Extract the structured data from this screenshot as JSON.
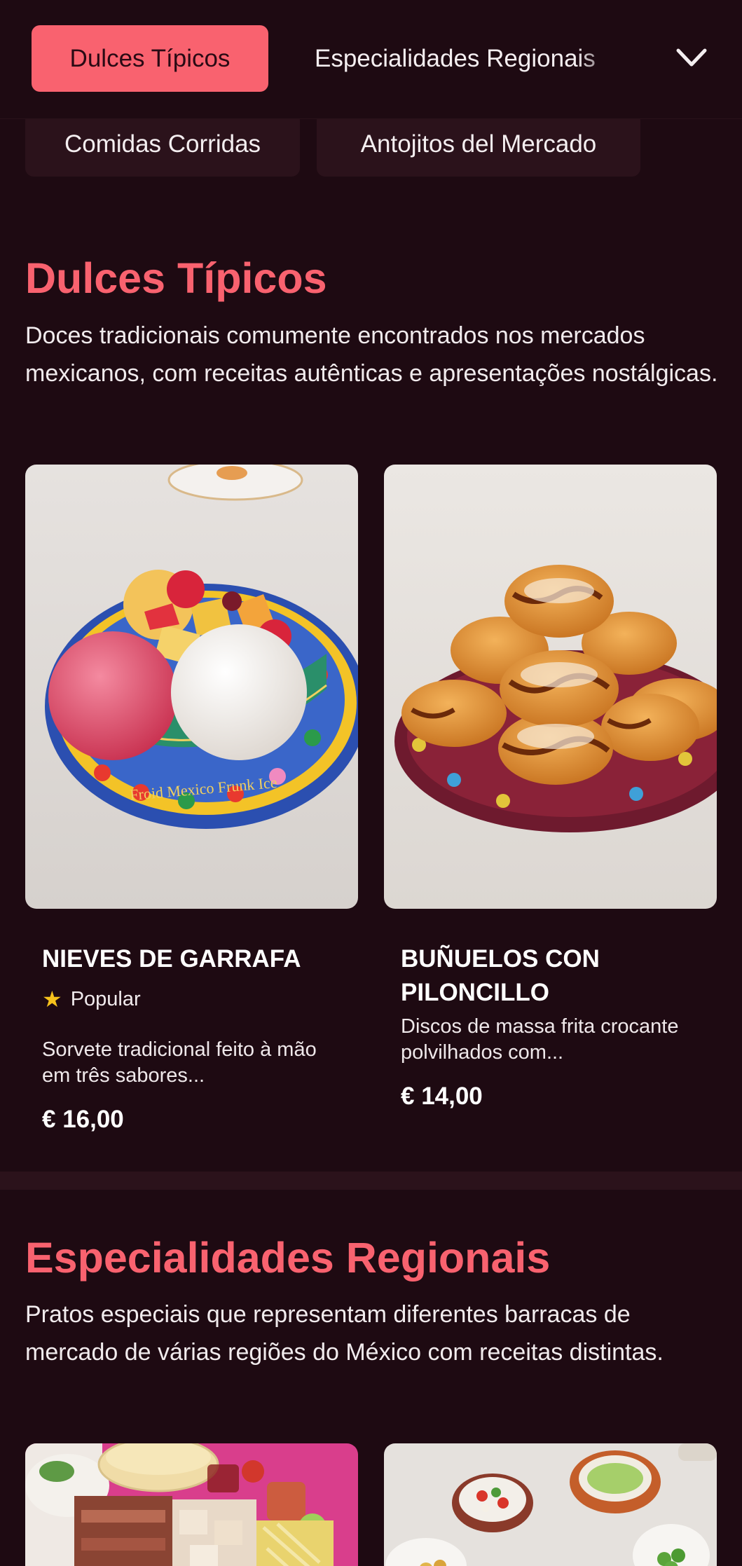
{
  "nav": {
    "active_tab": "Dulces Típicos",
    "next_tab": "Especialidades Regionais",
    "chips": [
      "Comidas Corridas",
      "Antojitos del Mercado"
    ]
  },
  "sections": [
    {
      "title": "Dulces Típicos",
      "description": "Doces tradicionais comumente encontrados nos mercados mexicanos, com receitas autênticas e apresentações nostálgicas.",
      "items": [
        {
          "name": "NIEVES DE GARRAFA",
          "badge": "Popular",
          "description": "Sorvete tradicional feito à mão em três sabores...",
          "price": "€ 16,00",
          "plate_text": "Froid Mexico Frunk Ice"
        },
        {
          "name": "BUÑUELOS CON PILONCILLO",
          "description": "Discos de massa frita crocante polvilhados com...",
          "price": "€ 14,00"
        }
      ]
    },
    {
      "title": "Especialidades Regionais",
      "description": "Pratos especiais que representam diferentes barracas de mercado de várias regiões do México com receitas distintas."
    }
  ],
  "colors": {
    "background": "#1e0a12",
    "accent": "#f9626f",
    "chip": "#2b121b",
    "star": "#f7c21c"
  },
  "icons": [
    "chevron-down-icon",
    "star-icon"
  ]
}
